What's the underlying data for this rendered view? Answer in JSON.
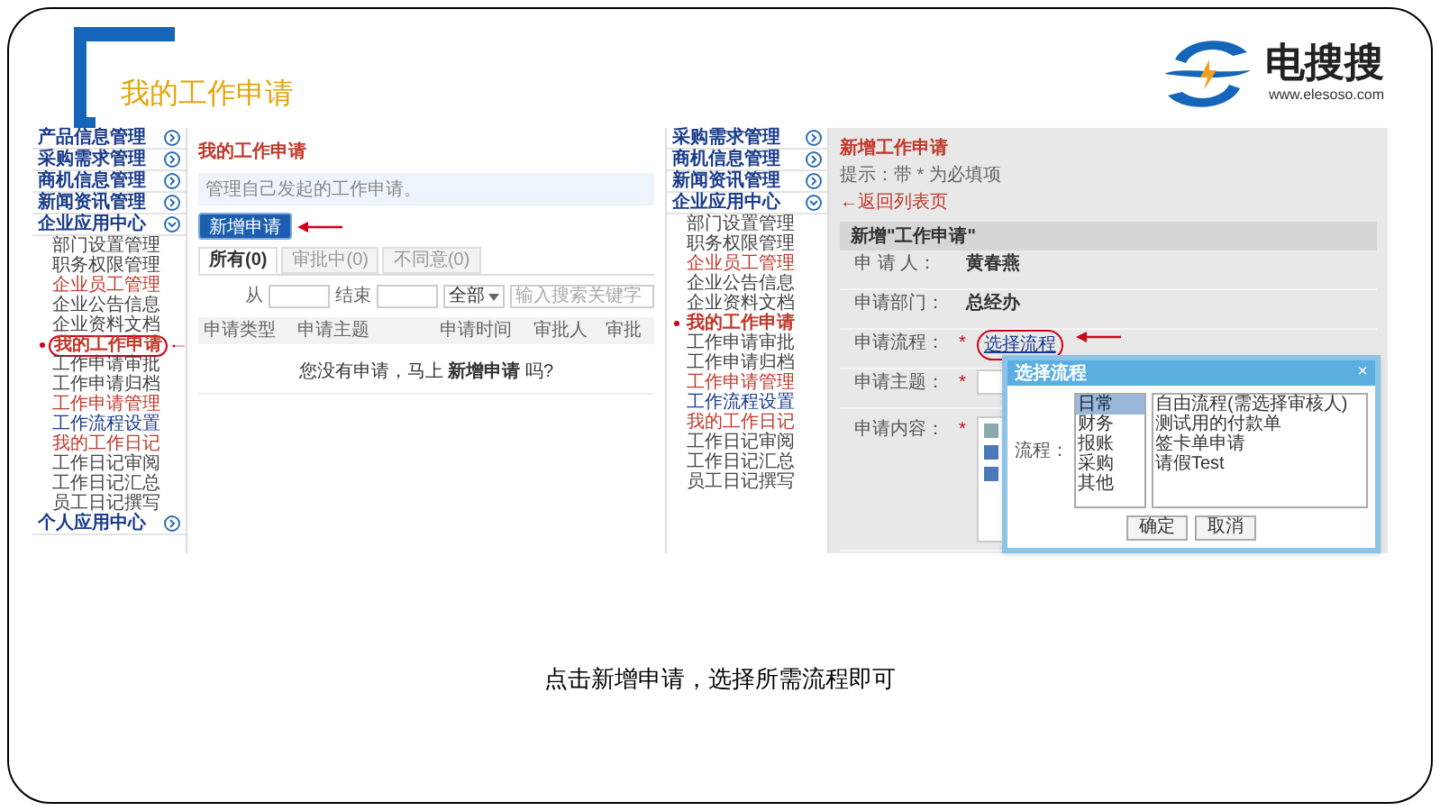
{
  "slide_title": "我的工作申请",
  "logo": {
    "name": "电搜搜",
    "url": "www.elesoso.com"
  },
  "left_screen": {
    "sidebar": [
      {
        "label": "产品信息管理",
        "expanded": false
      },
      {
        "label": "采购需求管理",
        "expanded": false
      },
      {
        "label": "商机信息管理",
        "expanded": false
      },
      {
        "label": "新闻资讯管理",
        "expanded": false
      },
      {
        "label": "企业应用中心",
        "expanded": true,
        "children": [
          {
            "label": "部门设置管理",
            "selected": false,
            "circled": false,
            "color": "#444444"
          },
          {
            "label": "职务权限管理",
            "selected": false,
            "circled": false,
            "color": "#444444"
          },
          {
            "label": "企业员工管理",
            "selected": false,
            "circled": false,
            "color": "#c0392b"
          },
          {
            "label": "企业公告信息",
            "selected": false,
            "circled": false,
            "color": "#444444"
          },
          {
            "label": "企业资料文档",
            "selected": false,
            "circled": false,
            "color": "#444444"
          },
          {
            "label": "我的工作申请",
            "selected": true,
            "circled": true,
            "color": "#c0392b"
          },
          {
            "label": "工作申请审批",
            "selected": false,
            "circled": false,
            "color": "#444444"
          },
          {
            "label": "工作申请归档",
            "selected": false,
            "circled": false,
            "color": "#444444"
          },
          {
            "label": "工作申请管理",
            "selected": false,
            "circled": false,
            "color": "#c0392b"
          },
          {
            "label": "工作流程设置",
            "selected": false,
            "circled": false,
            "color": "#1a3c8c"
          },
          {
            "label": "我的工作日记",
            "selected": false,
            "circled": false,
            "color": "#c0392b"
          },
          {
            "label": "工作日记审阅",
            "selected": false,
            "circled": false,
            "color": "#444444"
          },
          {
            "label": "工作日记汇总",
            "selected": false,
            "circled": false,
            "color": "#444444"
          },
          {
            "label": "员工日记撰写",
            "selected": false,
            "circled": false,
            "color": "#444444"
          }
        ]
      },
      {
        "label": "个人应用中心",
        "expanded": false
      }
    ],
    "heading": "我的工作申请",
    "info": "管理自己发起的工作申请。",
    "new_button": "新增申请",
    "tabs": [
      {
        "label": "所有(0)",
        "selected": true
      },
      {
        "label": "审批中(0)",
        "selected": false
      },
      {
        "label": "不同意(0)",
        "selected": false
      }
    ],
    "filters": {
      "from_label": "从",
      "to_label": "结束",
      "select": "全部",
      "search_placeholder": "输入搜索关键字"
    },
    "columns": [
      "申请类型",
      "申请主题",
      "申请时间",
      "审批人",
      "审批"
    ],
    "empty_message": "您没有申请，马上 **新增申请** 吗?"
  },
  "right_screen": {
    "sidebar": [
      {
        "label": "采购需求管理",
        "expanded": false
      },
      {
        "label": "商机信息管理",
        "expanded": false
      },
      {
        "label": "新闻资讯管理",
        "expanded": false
      },
      {
        "label": "企业应用中心",
        "expanded": true,
        "children": [
          {
            "label": "部门设置管理",
            "selected": false,
            "circled": false,
            "color": "#444444"
          },
          {
            "label": "职务权限管理",
            "selected": false,
            "circled": false,
            "color": "#444444"
          },
          {
            "label": "企业员工管理",
            "selected": false,
            "circled": false,
            "color": "#c0392b"
          },
          {
            "label": "企业公告信息",
            "selected": false,
            "circled": false,
            "color": "#444444"
          },
          {
            "label": "企业资料文档",
            "selected": false,
            "circled": false,
            "color": "#444444"
          },
          {
            "label": "我的工作申请",
            "selected": true,
            "circled": false,
            "color": "#c0392b"
          },
          {
            "label": "工作申请审批",
            "selected": false,
            "circled": false,
            "color": "#444444"
          },
          {
            "label": "工作申请归档",
            "selected": false,
            "circled": false,
            "color": "#444444"
          },
          {
            "label": "工作申请管理",
            "selected": false,
            "circled": false,
            "color": "#c0392b"
          },
          {
            "label": "工作流程设置",
            "selected": false,
            "circled": false,
            "color": "#1a3c8c"
          },
          {
            "label": "我的工作日记",
            "selected": false,
            "circled": false,
            "color": "#c0392b"
          },
          {
            "label": "工作日记审阅",
            "selected": false,
            "circled": false,
            "color": "#444444"
          },
          {
            "label": "工作日记汇总",
            "selected": false,
            "circled": false,
            "color": "#444444"
          },
          {
            "label": "员工日记撰写",
            "selected": false,
            "circled": false,
            "color": "#444444"
          }
        ]
      }
    ],
    "heading": "新增工作申请",
    "hint": "提示：带 * 为必填项",
    "back_link": "←返回列表页",
    "section": "新增\"工作申请\"",
    "fields": [
      {
        "kind": "text",
        "label": "申 请 人：",
        "value": "黄春燕"
      },
      {
        "kind": "text",
        "label": "申请部门：",
        "value": "总经办"
      },
      {
        "kind": "link",
        "label": "申请流程：",
        "required": "*",
        "value": "选择流程"
      },
      {
        "kind": "input",
        "label": "申请主题：",
        "required": "*"
      },
      {
        "kind": "editor",
        "label": "申请内容：",
        "required": "*"
      }
    ],
    "dialog": {
      "title": "选择流程",
      "close": "×",
      "label": "流程：",
      "categories": [
        {
          "label": "日常",
          "selected": true
        },
        {
          "label": "财务",
          "selected": false
        },
        {
          "label": "报账",
          "selected": false
        },
        {
          "label": "采购",
          "selected": false
        },
        {
          "label": "其他",
          "selected": false
        }
      ],
      "flows": [
        "自由流程(需选择审核人)",
        "测试用的付款单",
        "签卡单申请",
        "请假Test"
      ],
      "buttons": [
        "确定",
        "取消"
      ]
    }
  },
  "caption": "点击新增申请，选择所需流程即可"
}
